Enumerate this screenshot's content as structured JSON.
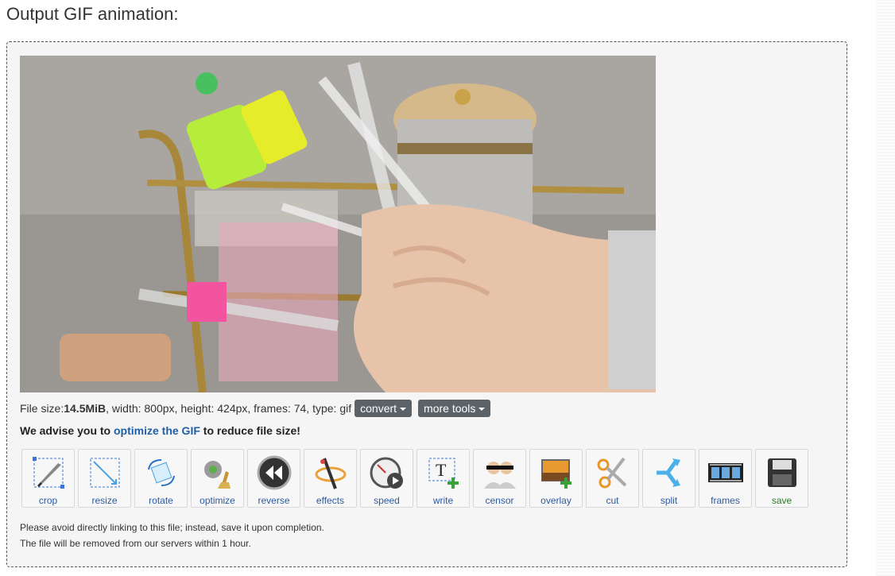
{
  "page": {
    "title": "Output GIF animation:"
  },
  "file_info": {
    "size_label": "File size: ",
    "size_value": "14.5MiB",
    "rest": ", width: 800px, height: 424px, frames: 74, type: gif",
    "convert_label": "convert",
    "more_tools_label": "more tools"
  },
  "advice": {
    "prefix": "We advise you to ",
    "link": "optimize the GIF",
    "suffix": " to reduce file size!"
  },
  "tools": [
    {
      "label": "crop",
      "icon": "crop-icon"
    },
    {
      "label": "resize",
      "icon": "resize-icon"
    },
    {
      "label": "rotate",
      "icon": "rotate-icon"
    },
    {
      "label": "optimize",
      "icon": "optimize-icon"
    },
    {
      "label": "reverse",
      "icon": "reverse-icon"
    },
    {
      "label": "effects",
      "icon": "effects-icon"
    },
    {
      "label": "speed",
      "icon": "speed-icon"
    },
    {
      "label": "write",
      "icon": "write-icon"
    },
    {
      "label": "censor",
      "icon": "censor-icon"
    },
    {
      "label": "overlay",
      "icon": "overlay-icon"
    },
    {
      "label": "cut",
      "icon": "cut-icon"
    },
    {
      "label": "split",
      "icon": "split-icon"
    },
    {
      "label": "frames",
      "icon": "frames-icon"
    },
    {
      "label": "save",
      "icon": "save-icon"
    }
  ],
  "notes": {
    "line1": "Please avoid directly linking to this file; instead, save it upon completion.",
    "line2": "The file will be removed from our servers within 1 hour."
  },
  "colors": {
    "link": "#1f5fa3",
    "dropdown_bg": "#5b6268",
    "panel_bg": "#f5f5f5"
  }
}
